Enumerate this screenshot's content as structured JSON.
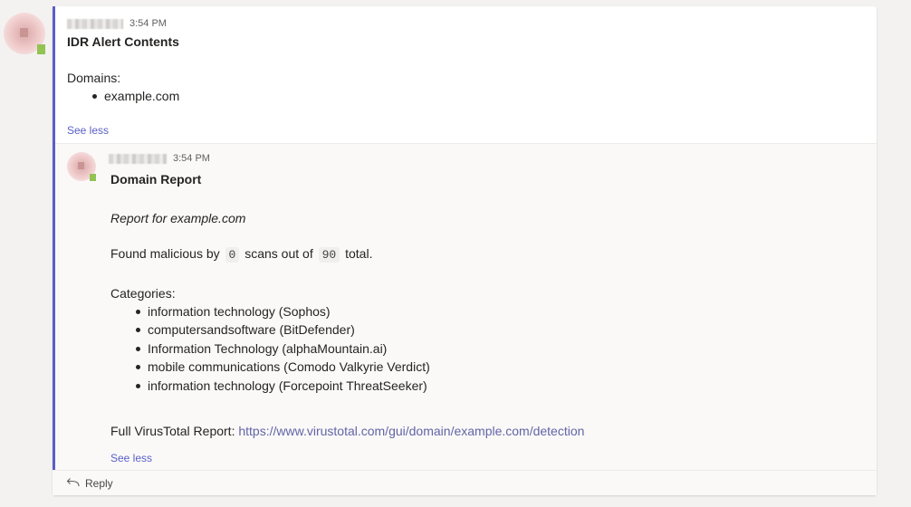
{
  "message": {
    "time": "3:54 PM",
    "title": "IDR Alert Contents",
    "domains_label": "Domains:",
    "domains": [
      "example.com"
    ],
    "see_less": "See less"
  },
  "reply": {
    "time": "3:54 PM",
    "title": "Domain Report",
    "subtitle": "Report for example.com",
    "found_prefix": "Found malicious by",
    "malicious_count": "0",
    "found_middle": "scans out of",
    "total_count": "90",
    "found_suffix": "total.",
    "categories_label": "Categories:",
    "categories": [
      "information technology (Sophos)",
      "computersandsoftware (BitDefender)",
      "Information Technology (alphaMountain.ai)",
      "mobile communications (Comodo Valkyrie Verdict)",
      "information technology (Forcepoint ThreatSeeker)"
    ],
    "report_label": "Full VirusTotal Report:",
    "report_url": "https://www.virustotal.com/gui/domain/example.com/detection",
    "see_less": "See less"
  },
  "footer": {
    "reply_label": "Reply",
    "reply_icon": "reply-arrow-icon"
  },
  "colors": {
    "accent": "#5b5fc7",
    "link": "#6264a7",
    "presence": "#92c353"
  }
}
